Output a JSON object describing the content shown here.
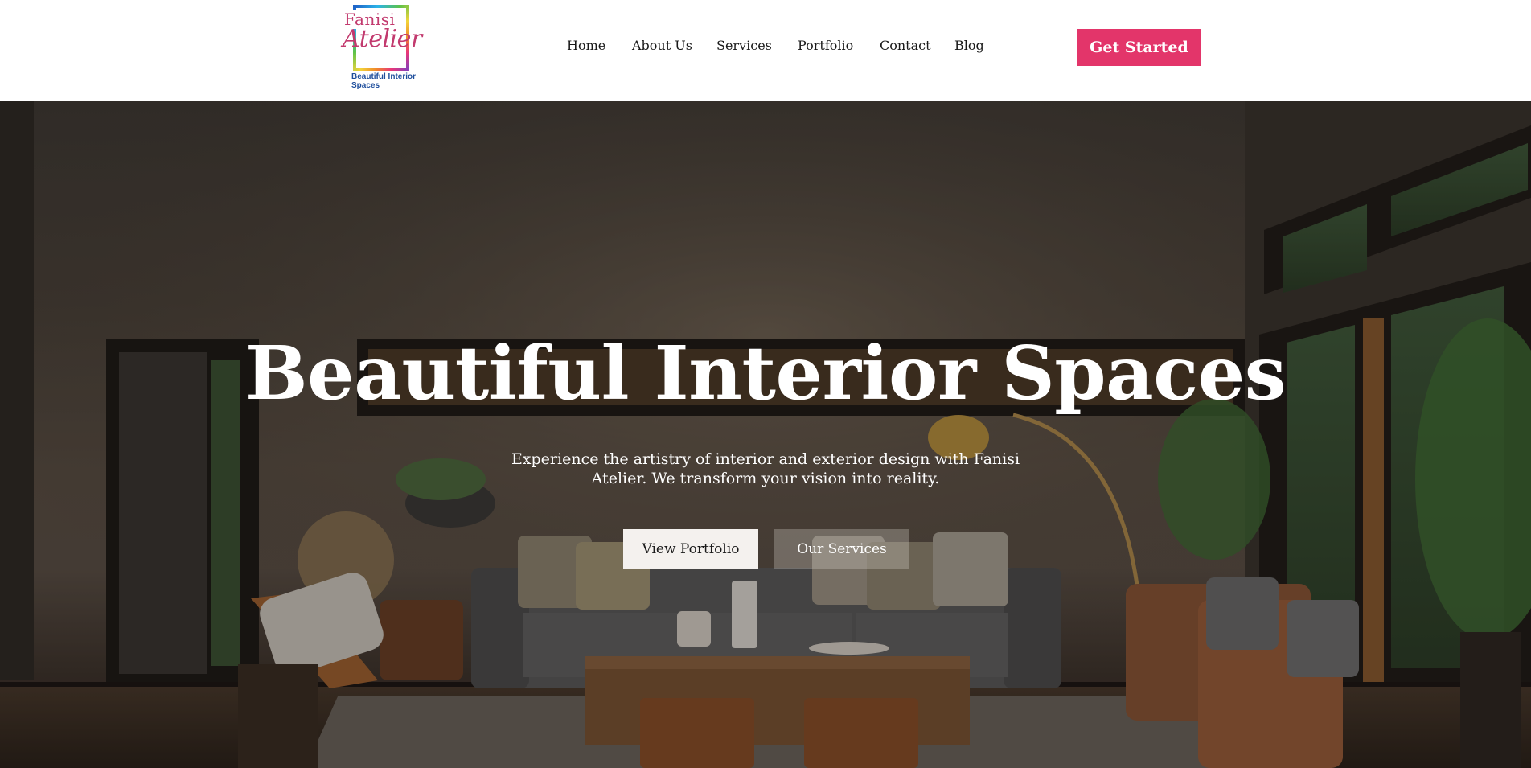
{
  "brand": {
    "logo_line1": "Fanisi",
    "logo_line2": "Atelier",
    "tagline": "Beautiful Interior Spaces"
  },
  "nav": {
    "items": [
      {
        "label": "Home"
      },
      {
        "label": "About Us"
      },
      {
        "label": "Services"
      },
      {
        "label": "Portfolio"
      },
      {
        "label": "Contact"
      },
      {
        "label": "Blog"
      }
    ],
    "cta_label": "Get Started"
  },
  "hero": {
    "title": "Beautiful Interior Spaces",
    "subtitle": "Experience the artistry of interior and exterior design with Fanisi Atelier. We transform your vision into reality.",
    "primary_button": "View Portfolio",
    "secondary_button": "Our Services"
  },
  "colors": {
    "accent": "#e3356a",
    "nav_text": "#1a1a1a",
    "logo_text": "#c23a6e",
    "tagline": "#1e4e9c"
  }
}
